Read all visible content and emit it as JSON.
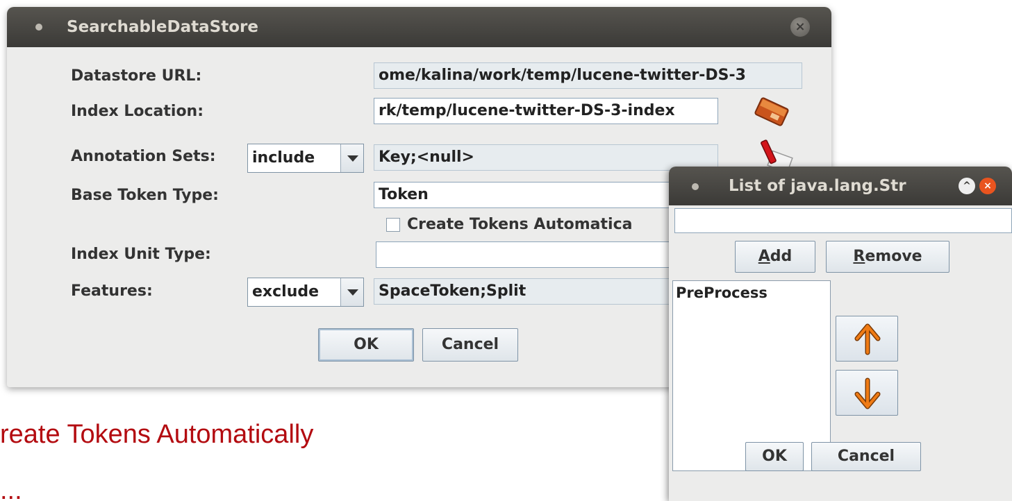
{
  "main_dialog": {
    "title": "SearchableDataStore",
    "close_glyph": "×",
    "labels": {
      "datastore_url": "Datastore URL:",
      "index_location": "Index Location:",
      "annotation_sets": "Annotation Sets:",
      "base_token_type": "Base Token Type:",
      "index_unit_type": "Index Unit Type:",
      "features": "Features:"
    },
    "values": {
      "datastore_url": "ome/kalina/work/temp/lucene-twitter-DS-3",
      "index_location": "rk/temp/lucene-twitter-DS-3-index",
      "annotation_sets_mode": "include",
      "annotation_sets": "Key;<null>",
      "base_token_type": "Token",
      "index_unit_type": "",
      "features_mode": "exclude",
      "features": "SpaceToken;Split"
    },
    "checkbox_label": "Create Tokens Automatica",
    "buttons": {
      "ok": "OK",
      "cancel": "Cancel"
    }
  },
  "list_dialog": {
    "title": "List of java.lang.Str",
    "new_item_value": "",
    "buttons": {
      "add_mnemonic": "A",
      "add_rest": "dd",
      "remove_mnemonic": "R",
      "remove_rest": "emove",
      "ok": "OK",
      "cancel": "Cancel"
    },
    "items": [
      "PreProcess"
    ]
  },
  "slide": {
    "line1": "reate Tokens Automatically",
    "line2": "..."
  },
  "colors": {
    "accent_red": "#b30b10",
    "titlebar": "#3c3b38",
    "arrow_orange": "#e8700f"
  }
}
